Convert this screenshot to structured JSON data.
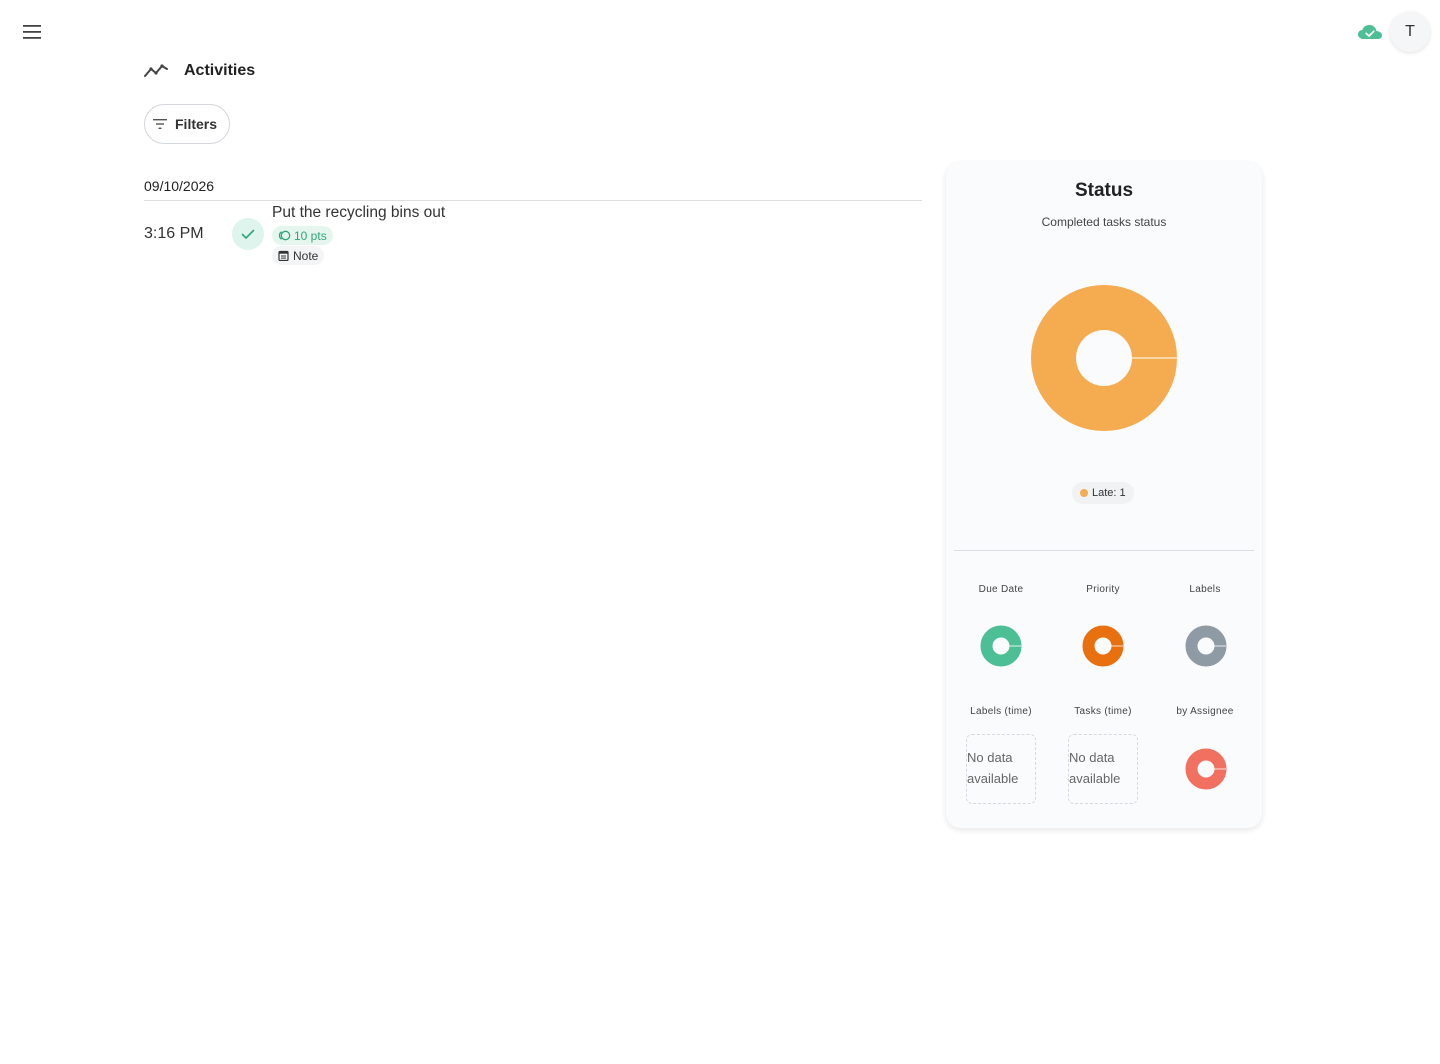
{
  "header": {
    "menu_icon": "hamburger-menu-icon",
    "sync_icon": "cloud-check-icon",
    "sync_color": "#4cbf96",
    "avatar_initial": "T"
  },
  "page": {
    "title": "Activities",
    "title_icon": "trending-line-icon",
    "filters_label": "Filters",
    "filters_icon": "filter-lines-icon"
  },
  "activity_groups": [
    {
      "date": "09/10/2026",
      "items": [
        {
          "time": "3:16 PM",
          "status_icon": "check-icon",
          "title": "Put the recycling bins out",
          "points": "10 pts",
          "points_icon": "coin-icon",
          "note_label": "Note",
          "note_icon": "notepad-icon"
        }
      ]
    }
  ],
  "status_card": {
    "title": "Status",
    "subtitle": "Completed tasks status",
    "legend": [
      {
        "label": "Late: 1",
        "color": "#f5ab4f"
      }
    ],
    "mini_charts": [
      {
        "label": "Due Date",
        "color": "#4cbf96",
        "has_data": true
      },
      {
        "label": "Priority",
        "color": "#e8700f",
        "has_data": true
      },
      {
        "label": "Labels",
        "color": "#8e9aa4",
        "has_data": true
      },
      {
        "label": "Labels (time)",
        "has_data": false,
        "empty_text": "No data available"
      },
      {
        "label": "Tasks (time)",
        "has_data": false,
        "empty_text": "No data available"
      },
      {
        "label": "by Assignee",
        "color": "#f2705f",
        "has_data": true
      }
    ]
  },
  "chart_data": {
    "type": "pie",
    "title": "Status",
    "subtitle": "Completed tasks status",
    "categories": [
      "Late"
    ],
    "values": [
      1
    ],
    "colors": [
      "#f5ab4f"
    ],
    "donut": true
  }
}
